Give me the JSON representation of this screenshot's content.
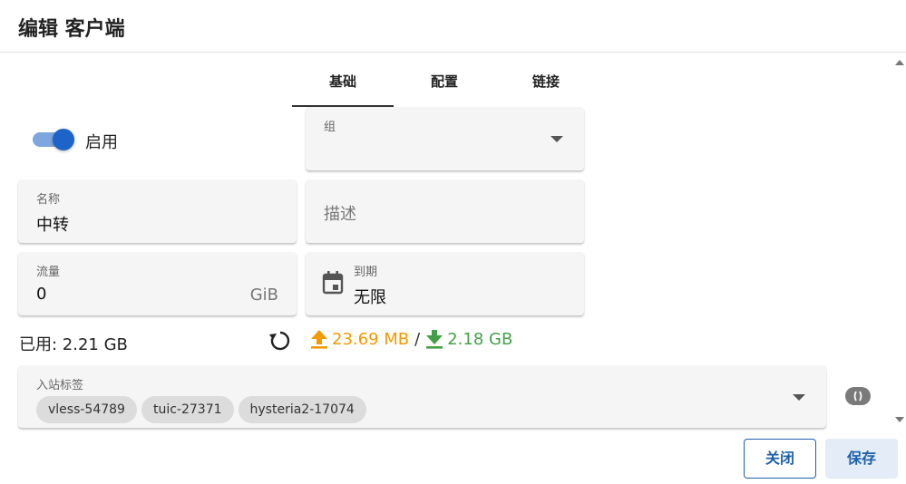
{
  "dialog": {
    "title": "编辑 客户端"
  },
  "tabs": [
    {
      "label": "基础",
      "active": true
    },
    {
      "label": "配置",
      "active": false
    },
    {
      "label": "链接",
      "active": false
    }
  ],
  "enable": {
    "label": "启用",
    "checked": true
  },
  "group": {
    "label": "组",
    "value": ""
  },
  "name": {
    "label": "名称",
    "value": "中转"
  },
  "description": {
    "placeholder": "描述"
  },
  "traffic_limit": {
    "label": "流量",
    "value": "0",
    "unit": "GiB"
  },
  "expiry": {
    "label": "到期",
    "value": "无限",
    "icon": "calendar-icon"
  },
  "usage": {
    "used_text": "已用: 2.21 GB",
    "upload": "23.69 MB",
    "separator": "/",
    "download": "2.18 GB",
    "upload_color": "#f29a00",
    "download_color": "#43a047"
  },
  "inbound_tags": {
    "label": "入站标签",
    "chips": [
      "vless-54789",
      "tuic-27371",
      "hysteria2-17074"
    ]
  },
  "buttons": {
    "close": "关闭",
    "save": "保存"
  },
  "colors": {
    "primary": "#1e63c9",
    "primary_dark": "#1e5fa8"
  }
}
